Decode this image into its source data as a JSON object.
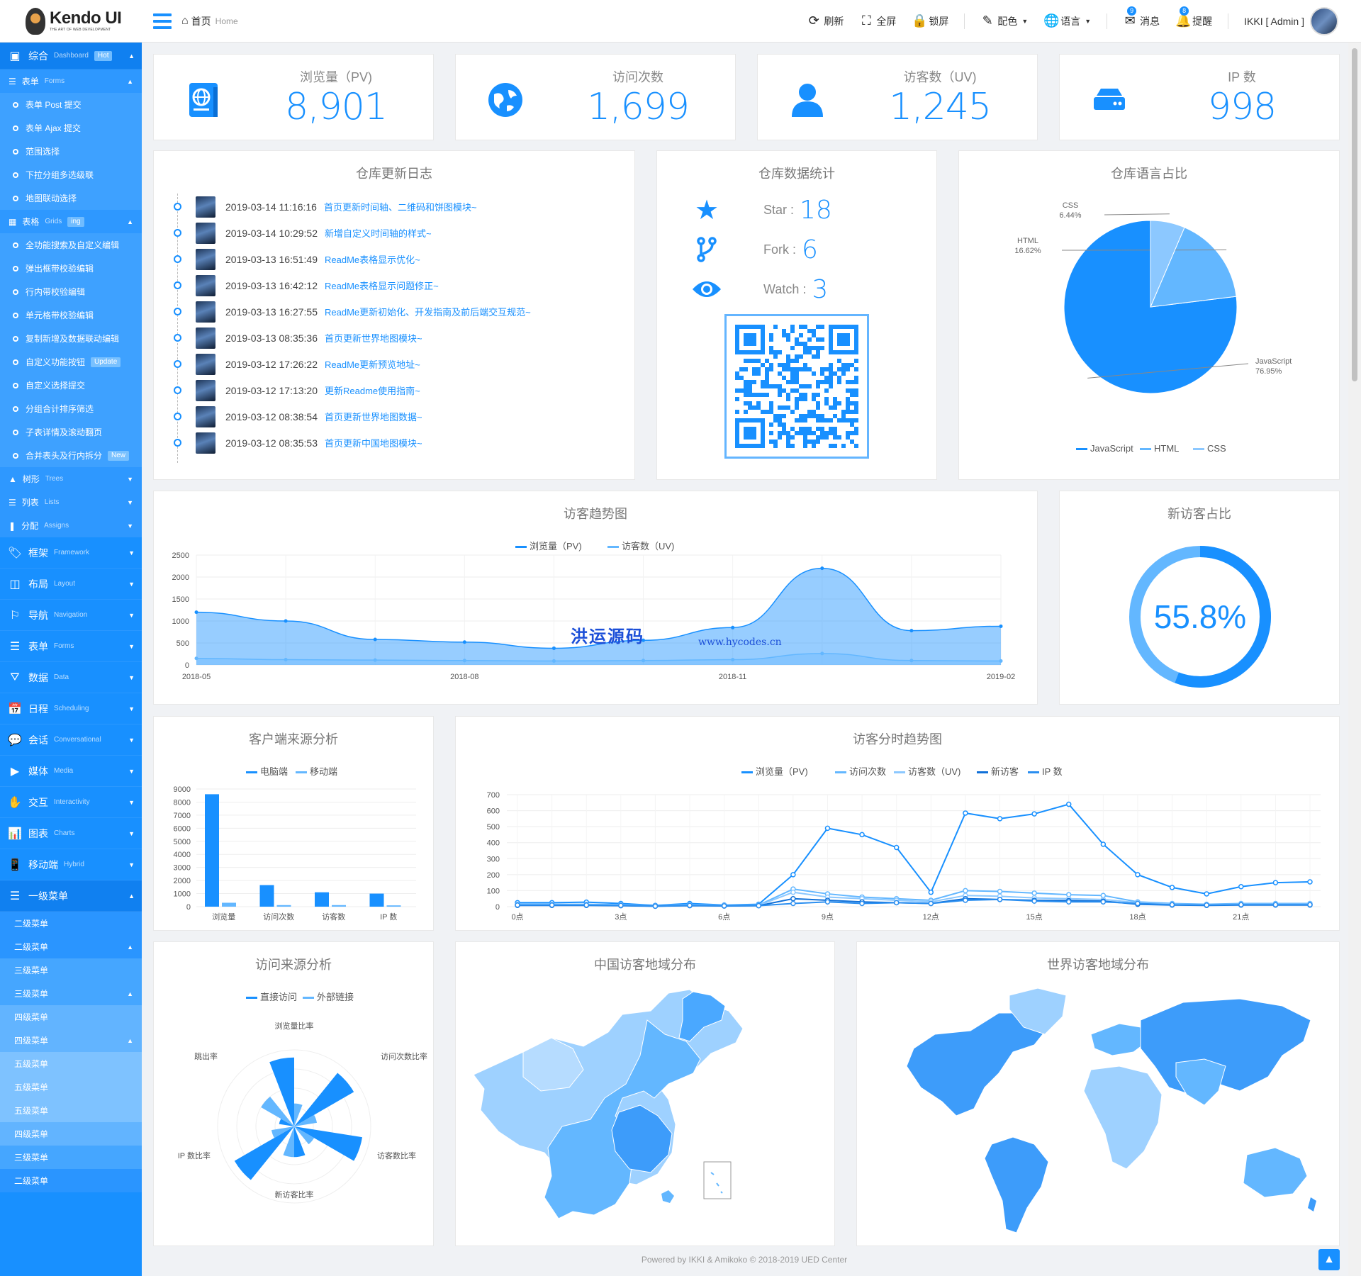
{
  "header": {
    "logo_name": "Kendo UI",
    "logo_sub": "THE ART OF WEB DEVELOPMENT",
    "crumb_home": "首页",
    "crumb_home_en": "Home",
    "toolbar": {
      "refresh": "刷新",
      "fullscreen": "全屏",
      "lock": "锁屏",
      "theme": "配色",
      "lang": "语言",
      "msg": "消息",
      "msg_count": "9",
      "remind": "提醒",
      "remind_count": "8",
      "user": "IKKI [ Admin ]"
    }
  },
  "sidebar": {
    "dashboard": {
      "label": "综合",
      "en": "Dashboard",
      "tag": "Hot"
    },
    "forms": {
      "label": "表单",
      "en": "Forms",
      "items": [
        "表单 Post 提交",
        "表单 Ajax 提交",
        "范围选择",
        "下拉分组多选级联",
        "地图联动选择"
      ]
    },
    "grids": {
      "label": "表格",
      "en": "Grids",
      "tag": "ing",
      "items": [
        "全功能搜索及自定义编辑",
        "弹出框带校验编辑",
        "行内带校验编辑",
        "单元格带校验编辑",
        "复制新增及数据联动编辑",
        "自定义功能按钮",
        "自定义选择提交",
        "分组合计排序筛选",
        "子表详情及滚动翻页",
        "合并表头及行内拆分"
      ],
      "item_tags": {
        "5": "Update",
        "9": "New"
      }
    },
    "trees": {
      "label": "树形",
      "en": "Trees"
    },
    "lists": {
      "label": "列表",
      "en": "Lists"
    },
    "assigns": {
      "label": "分配",
      "en": "Assigns"
    },
    "top": [
      {
        "label": "框架",
        "en": "Framework"
      },
      {
        "label": "布局",
        "en": "Layout"
      },
      {
        "label": "导航",
        "en": "Navigation"
      },
      {
        "label": "表单",
        "en": "Forms"
      },
      {
        "label": "数据",
        "en": "Data"
      },
      {
        "label": "日程",
        "en": "Scheduling"
      },
      {
        "label": "会话",
        "en": "Conversational"
      },
      {
        "label": "媒体",
        "en": "Media"
      },
      {
        "label": "交互",
        "en": "Interactivity"
      },
      {
        "label": "图表",
        "en": "Charts"
      },
      {
        "label": "移动端",
        "en": "Hybrid"
      }
    ],
    "level1": "一级菜单",
    "level2": "二级菜单",
    "level3": "三级菜单",
    "level4": "四级菜单",
    "level5": "五级菜单"
  },
  "stats": [
    {
      "label": "浏览量（PV)",
      "value": "8,901"
    },
    {
      "label": "访问次数",
      "value": "1,699"
    },
    {
      "label": "访客数（UV)",
      "value": "1,245"
    },
    {
      "label": "IP 数",
      "value": "998"
    }
  ],
  "changelog": {
    "title": "仓库更新日志",
    "entries": [
      {
        "time": "2019-03-14 11:16:16",
        "msg": "首页更新时间轴、二维码和饼图模块~"
      },
      {
        "time": "2019-03-14 10:29:52",
        "msg": "新增自定义时间轴的样式~"
      },
      {
        "time": "2019-03-13 16:51:49",
        "msg": "ReadMe表格显示优化~"
      },
      {
        "time": "2019-03-13 16:42:12",
        "msg": "ReadMe表格显示问题修正~"
      },
      {
        "time": "2019-03-13 16:27:55",
        "msg": "ReadMe更新初始化、开发指南及前后端交互规范~"
      },
      {
        "time": "2019-03-13 08:35:36",
        "msg": "首页更新世界地图模块~"
      },
      {
        "time": "2019-03-12 17:26:22",
        "msg": "ReadMe更新预览地址~"
      },
      {
        "time": "2019-03-12 17:13:20",
        "msg": "更新Readme使用指南~"
      },
      {
        "time": "2019-03-12 08:38:54",
        "msg": "首页更新世界地图数据~"
      },
      {
        "time": "2019-03-12 08:35:53",
        "msg": "首页更新中国地图模块~"
      }
    ]
  },
  "repo": {
    "title": "仓库数据统计",
    "star_label": "Star :",
    "star": "18",
    "fork_label": "Fork :",
    "fork": "6",
    "watch_label": "Watch :",
    "watch": "3"
  },
  "lang_title": "仓库语言占比",
  "trend_title": "访客趋势图",
  "newvisitor": {
    "title": "新访客占比",
    "value": "55.8%",
    "fraction": 0.558
  },
  "client_title": "客户端来源分析",
  "hourly_title": "访客分时趋势图",
  "source_title": "访问来源分析",
  "china_title": "中国访客地域分布",
  "world_title": "世界访客地域分布",
  "watermark": "洪运源码",
  "watermark_url": "www.hycodes.cn",
  "footer": "Powered by IKKI & Amikoko © 2018-2019 UED Center",
  "colors": {
    "primary": "#1890ff",
    "light": "#63b7ff",
    "lighter": "#9ed1ff"
  },
  "chart_data": [
    {
      "type": "pie",
      "title": "仓库语言占比",
      "categories": [
        "JavaScript",
        "HTML",
        "CSS"
      ],
      "values": [
        76.95,
        16.62,
        6.44
      ],
      "labels": [
        "JavaScript\n76.95%",
        "HTML\n16.62%",
        "CSS\n6.44%"
      ]
    },
    {
      "type": "area",
      "title": "访客趋势图",
      "x": [
        "2018-05",
        "2018-06",
        "2018-07",
        "2018-08",
        "2018-09",
        "2018-10",
        "2018-11",
        "2018-12",
        "2019-01",
        "2019-02"
      ],
      "x_ticks": [
        "2018-05",
        "2018-08",
        "2018-11",
        "2019-02"
      ],
      "ylim": [
        0,
        2500
      ],
      "y_ticks": [
        0,
        500,
        1000,
        1500,
        2000,
        2500
      ],
      "series": [
        {
          "name": "浏览量（PV)",
          "values": [
            1200,
            1000,
            580,
            520,
            380,
            560,
            850,
            2200,
            780,
            880
          ]
        },
        {
          "name": "访客数（UV)",
          "values": [
            150,
            120,
            110,
            100,
            90,
            100,
            120,
            260,
            100,
            90
          ]
        }
      ]
    },
    {
      "type": "bar",
      "title": "客户端来源分析",
      "categories": [
        "浏览量",
        "访问次数",
        "访客数",
        "IP 数"
      ],
      "ylim": [
        0,
        9000
      ],
      "y_ticks": [
        0,
        1000,
        2000,
        3000,
        4000,
        5000,
        6000,
        7000,
        8000,
        9000
      ],
      "series": [
        {
          "name": "电脑端",
          "values": [
            8600,
            1650,
            1100,
            1000
          ]
        },
        {
          "name": "移动端",
          "values": [
            300,
            120,
            120,
            100
          ]
        }
      ]
    },
    {
      "type": "line",
      "title": "访客分时趋势图",
      "x": [
        "0点",
        "1点",
        "2点",
        "3点",
        "4点",
        "5点",
        "6点",
        "7点",
        "8点",
        "9点",
        "10点",
        "11点",
        "12点",
        "13点",
        "14点",
        "15点",
        "16点",
        "17点",
        "18点",
        "19点",
        "20点",
        "21点",
        "22点",
        "23点"
      ],
      "x_ticks": [
        "0点",
        "3点",
        "6点",
        "9点",
        "12点",
        "15点",
        "18点",
        "21点"
      ],
      "ylim": [
        0,
        700
      ],
      "y_ticks": [
        0,
        100,
        200,
        300,
        400,
        500,
        600,
        700
      ],
      "series": [
        {
          "name": "浏览量（PV)",
          "values": [
            25,
            25,
            28,
            20,
            8,
            20,
            10,
            15,
            200,
            490,
            450,
            370,
            90,
            585,
            550,
            580,
            640,
            390,
            200,
            120,
            80,
            125,
            150,
            155
          ]
        },
        {
          "name": "访问次数",
          "values": [
            15,
            15,
            15,
            12,
            5,
            12,
            8,
            10,
            110,
            80,
            60,
            50,
            40,
            100,
            95,
            85,
            75,
            70,
            30,
            20,
            15,
            20,
            20,
            20
          ]
        },
        {
          "name": "访客数（UV)",
          "values": [
            12,
            12,
            12,
            10,
            4,
            10,
            6,
            8,
            90,
            60,
            50,
            40,
            30,
            70,
            65,
            55,
            50,
            45,
            25,
            15,
            12,
            15,
            15,
            15
          ]
        },
        {
          "name": "新访客",
          "values": [
            8,
            8,
            8,
            6,
            3,
            6,
            4,
            6,
            50,
            40,
            30,
            25,
            20,
            50,
            45,
            40,
            38,
            35,
            15,
            10,
            8,
            10,
            10,
            10
          ]
        },
        {
          "name": "IP 数",
          "values": [
            10,
            10,
            10,
            8,
            3,
            8,
            5,
            6,
            20,
            30,
            20,
            25,
            20,
            40,
            45,
            35,
            30,
            30,
            20,
            12,
            10,
            12,
            12,
            12
          ]
        }
      ]
    },
    {
      "type": "polar-bar",
      "title": "访问来源分析",
      "categories": [
        "浏览量比率",
        "访问次数比率",
        "访客数比率",
        "新访客比率",
        "IP 数比率",
        "跳出率"
      ],
      "series": [
        {
          "name": "直接访问",
          "values": [
            0.9,
            0.9,
            0.9,
            0.4,
            0.9,
            0.2
          ]
        },
        {
          "name": "外部链接",
          "values": [
            0.3,
            0.3,
            0.3,
            0.4,
            0.3,
            0.5
          ]
        }
      ]
    }
  ]
}
